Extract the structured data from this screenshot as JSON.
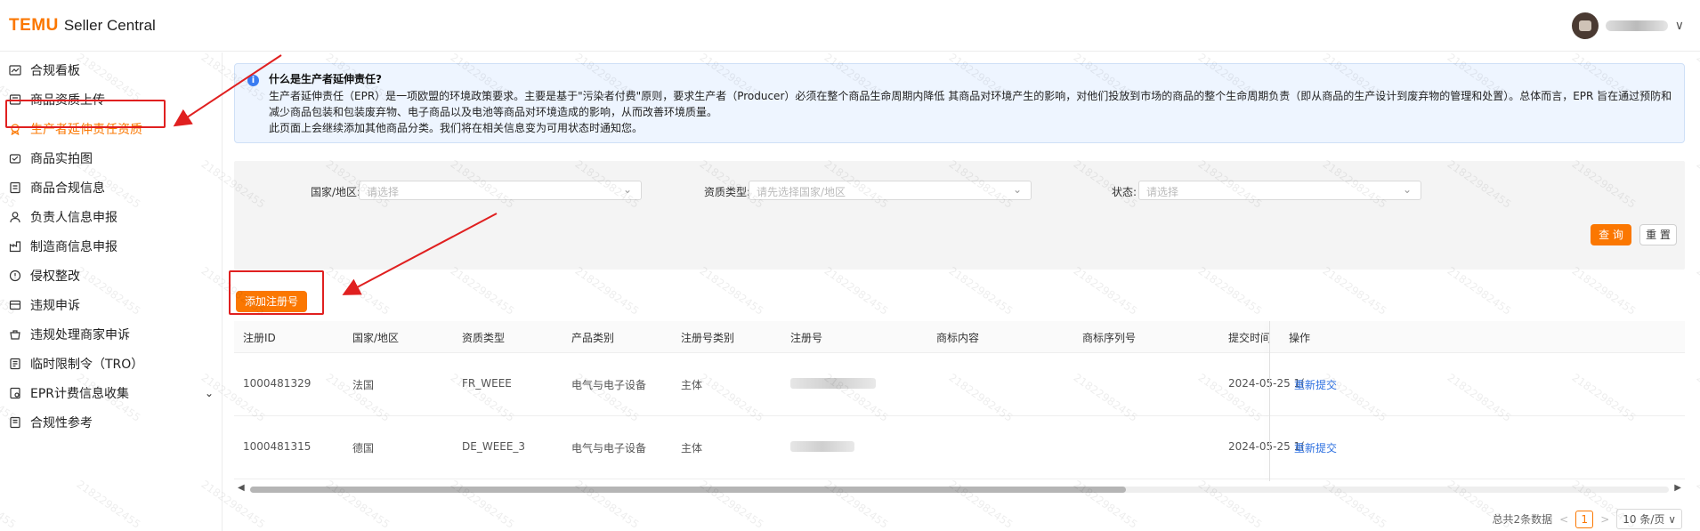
{
  "header": {
    "logo_brand": "TEMU",
    "logo_suffix": "Seller Central",
    "user_chevron": "∨"
  },
  "sidebar": {
    "items": [
      {
        "label": "合规看板",
        "icon": "dashboard-icon"
      },
      {
        "label": "商品资质上传",
        "icon": "upload-icon"
      },
      {
        "label": "生产者延伸责任资质",
        "icon": "certificate-icon",
        "active": true
      },
      {
        "label": "商品实拍图",
        "icon": "camera-icon"
      },
      {
        "label": "商品合规信息",
        "icon": "document-icon"
      },
      {
        "label": "负责人信息申报",
        "icon": "person-icon"
      },
      {
        "label": "制造商信息申报",
        "icon": "factory-icon"
      },
      {
        "label": "侵权整改",
        "icon": "shield-icon"
      },
      {
        "label": "违规申诉",
        "icon": "appeal-icon"
      },
      {
        "label": "违规处理商家申诉",
        "icon": "merchant-appeal-icon"
      },
      {
        "label": "临时限制令（TRO）",
        "icon": "order-icon"
      },
      {
        "label": "EPR计费信息收集",
        "icon": "billing-icon",
        "caret": "⌄"
      },
      {
        "label": "合规性参考",
        "icon": "reference-icon"
      }
    ]
  },
  "notice": {
    "icon": "i",
    "title": "什么是生产者延伸责任?",
    "line1": "生产者延伸责任（EPR）是一项欧盟的环境政策要求。主要是基于\"污染者付费\"原则，要求生产者（Producer）必须在整个商品生命周期内降低 其商品对环境产生的影响，对他们投放到市场的商品的整个生命周期负责（即从商品的生产设计到废弃物的管理和处置）。总体而言，EPR 旨在通过预防和",
    "line2": "减少商品包装和包装废弃物、电子商品以及电池等商品对环境造成的影响，从而改善环境质量。",
    "line3": "此页面上会继续添加其他商品分类。我们将在相关信息变为可用状态时通知您。"
  },
  "filters": {
    "country_label": "国家/地区:",
    "country_placeholder": "请选择",
    "type_label": "资质类型:",
    "type_placeholder": "请先选择国家/地区",
    "status_label": "状态:",
    "status_placeholder": "请选择",
    "query_button": "查 询",
    "reset_button": "重 置"
  },
  "add_button": "添加注册号",
  "table": {
    "headers": [
      "注册ID",
      "国家/地区",
      "资质类型",
      "产品类别",
      "注册号类别",
      "注册号",
      "商标内容",
      "商标序列号",
      "提交时间",
      "操作"
    ],
    "rows": [
      {
        "id": "1000481329",
        "country": "法国",
        "type": "FR_WEEE",
        "category": "电气与电子设备",
        "reg_kind": "主体",
        "submit_time": "2024-05-25 1(",
        "action": "重新提交"
      },
      {
        "id": "1000481315",
        "country": "德国",
        "type": "DE_WEEE_3",
        "category": "电气与电子设备",
        "reg_kind": "主体",
        "submit_time": "2024-05-25 1(",
        "action": "重新提交"
      }
    ]
  },
  "scrollbar": {
    "left_arrow": "◀",
    "right_arrow": "▶"
  },
  "pagination": {
    "total": "总共2条数据",
    "prev": "<",
    "current": "1",
    "next": ">",
    "page_size": "10 条/页 ∨"
  },
  "watermark_text": "21822982455"
}
